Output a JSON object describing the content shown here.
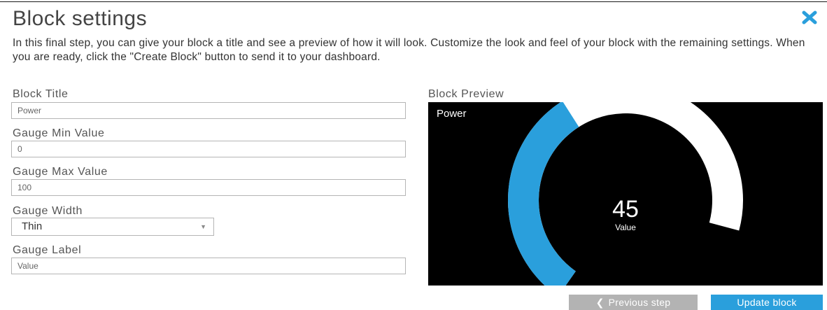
{
  "dialog": {
    "title": "Block settings",
    "close_icon": "close-x-icon",
    "description": "In this final step, you can give your block a title and see a preview of how it will look. Customize the look and feel of your block with the remaining settings. When you are ready, click the \"Create Block\" button to send it to your dashboard."
  },
  "form": {
    "block_title": {
      "label": "Block Title",
      "value": "Power"
    },
    "gauge_min": {
      "label": "Gauge Min Value",
      "value": "0"
    },
    "gauge_max": {
      "label": "Gauge Max Value",
      "value": "100"
    },
    "gauge_width": {
      "label": "Gauge Width",
      "selected": "Thin"
    },
    "gauge_label": {
      "label": "Gauge Label",
      "value": "Value"
    }
  },
  "preview": {
    "label": "Block Preview",
    "title": "Power",
    "value": "45",
    "value_label": "Value",
    "min": 0,
    "max": 100,
    "fraction": 0.45,
    "fill_color": "#2a9fdc",
    "track_color": "#ffffff",
    "background": "#000000"
  },
  "buttons": {
    "previous": "Previous step",
    "previous_icon": "chevron-left-icon",
    "update": "Update block"
  },
  "colors": {
    "accent": "#2a9fdc",
    "close_icon": "#2a9fdc",
    "secondary_button": "#b3b3b3"
  }
}
